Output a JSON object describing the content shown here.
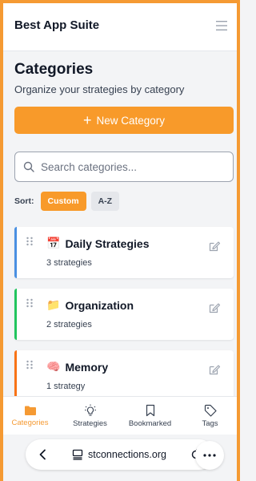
{
  "header": {
    "title": "Best App Suite",
    "menu_icon": "hamburger-icon"
  },
  "page": {
    "title": "Categories",
    "subtitle": "Organize your strategies by category",
    "new_button_label": "New Category",
    "search_placeholder": "Search categories...",
    "sort_label": "Sort:",
    "sort_options": [
      "Custom",
      "A-Z"
    ],
    "sort_selected": "Custom"
  },
  "categories": [
    {
      "emoji": "📅",
      "name": "Daily Strategies",
      "count": "3 strategies",
      "color": "#4a90e2"
    },
    {
      "emoji": "📁",
      "name": "Organization",
      "count": "2 strategies",
      "color": "#22c55e"
    },
    {
      "emoji": "🧠",
      "name": "Memory",
      "count": "1 strategy",
      "color": "#f97316"
    }
  ],
  "nav": {
    "items": [
      {
        "label": "Categories",
        "icon": "folder-icon"
      },
      {
        "label": "Strategies",
        "icon": "lightbulb-icon"
      },
      {
        "label": "Bookmarked",
        "icon": "bookmark-icon"
      },
      {
        "label": "Tags",
        "icon": "tag-icon"
      }
    ],
    "active": "Categories"
  },
  "browser": {
    "url": "stconnections.org"
  },
  "colors": {
    "accent": "#f89a2a",
    "frame": "#f59a33"
  }
}
